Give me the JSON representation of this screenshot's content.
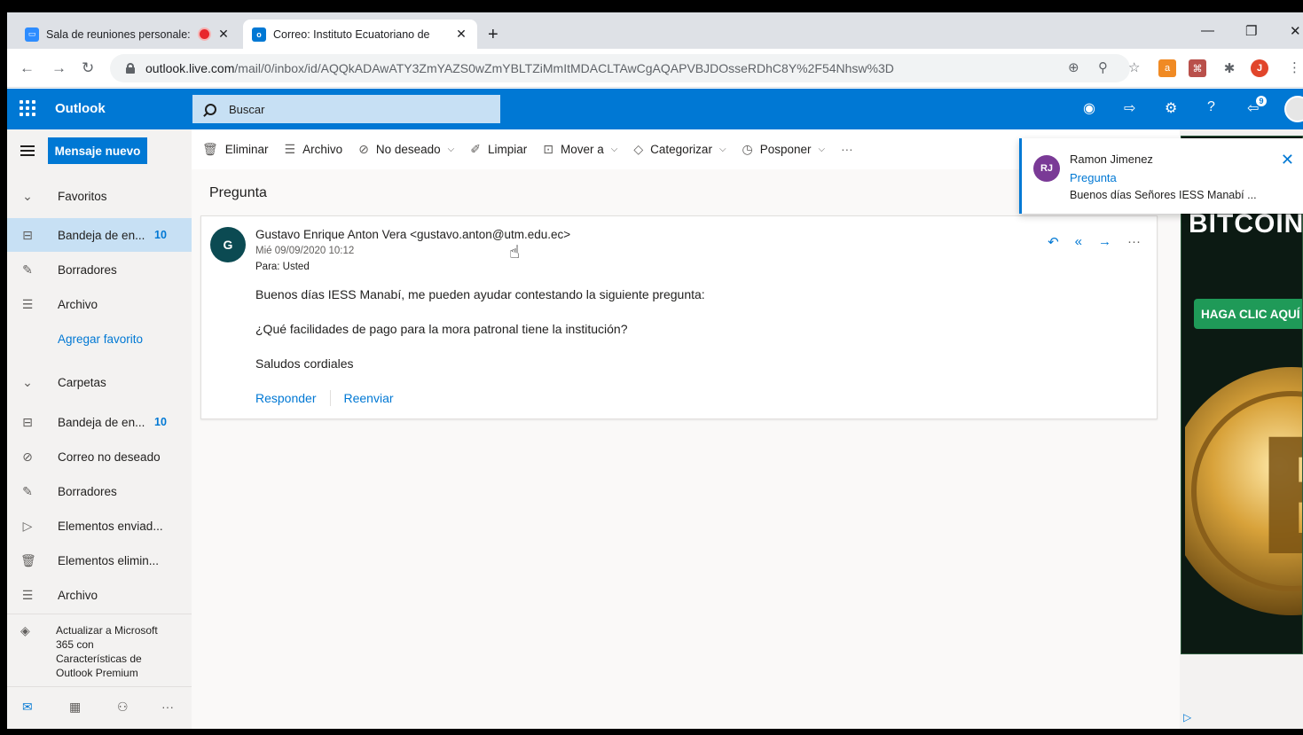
{
  "browser": {
    "tabs": [
      {
        "title": "Sala de reuniones personale:",
        "active": false,
        "recording": true
      },
      {
        "title": "Correo: Instituto Ecuatoriano de",
        "active": true,
        "recording": false
      }
    ],
    "url_host": "outlook.live.com",
    "url_path": "/mail/0/inbox/id/AQQkADAwATY3ZmYAZS0wZmYBLTZiMmItMDACLTAwCgAQAPVBJDOsseRDhC8Y%2F54Nhsw%3D",
    "profile_initial": "J",
    "new_tab_symbol": "+"
  },
  "outlook": {
    "brand": "Outlook",
    "search_placeholder": "Buscar",
    "notif_count": "9",
    "colors": {
      "accent": "#0078d4",
      "selected": "#c7e0f4"
    }
  },
  "nav": {
    "new_mail": "Mensaje nuevo",
    "favoritos": "Favoritos",
    "fav_items": [
      {
        "label": "Bandeja de en...",
        "count": "10",
        "icon": "inbox-icon"
      },
      {
        "label": "Borradores",
        "icon": "pencil-icon"
      },
      {
        "label": "Archivo",
        "icon": "archive-icon"
      },
      {
        "label": "Agregar favorito"
      }
    ],
    "carpetas": "Carpetas",
    "folder_items": [
      {
        "label": "Bandeja de en...",
        "count": "10",
        "icon": "inbox-icon"
      },
      {
        "label": "Correo no deseado",
        "icon": "blocked-icon"
      },
      {
        "label": "Borradores",
        "icon": "pencil-icon"
      },
      {
        "label": "Elementos enviad...",
        "icon": "send-icon"
      },
      {
        "label": "Elementos elimin...",
        "icon": "trash-icon"
      },
      {
        "label": "Archivo",
        "icon": "archive-icon"
      }
    ],
    "upgrade": "Actualizar a Microsoft 365 con Características de Outlook Premium"
  },
  "commands": {
    "eliminar": "Eliminar",
    "archivo": "Archivo",
    "no_deseado": "No deseado",
    "limpiar": "Limpiar",
    "mover": "Mover a",
    "categorizar": "Categorizar",
    "posponer": "Posponer",
    "more": "···"
  },
  "message": {
    "subject": "Pregunta",
    "avatar_initial": "G",
    "from": "Gustavo Enrique Anton Vera <gustavo.anton@utm.edu.ec>",
    "date": "Mié 09/09/2020 10:12",
    "to": "Para:  Usted",
    "body": [
      "Buenos días IESS Manabí, me pueden ayudar contestando la siguiente pregunta:",
      "¿Qué facilidades de pago para la mora patronal tiene la institución?",
      "Saludos cordiales"
    ],
    "reply": "Responder",
    "forward": "Reenviar"
  },
  "toast": {
    "initials": "RJ",
    "sender": "Ramon Jimenez",
    "subject": "Pregunta",
    "preview": "Buenos días Señores IESS Manabí  ..."
  },
  "ad": {
    "headline": "BITCOIN",
    "cta": "HAGA CLIC AQUÍ"
  }
}
